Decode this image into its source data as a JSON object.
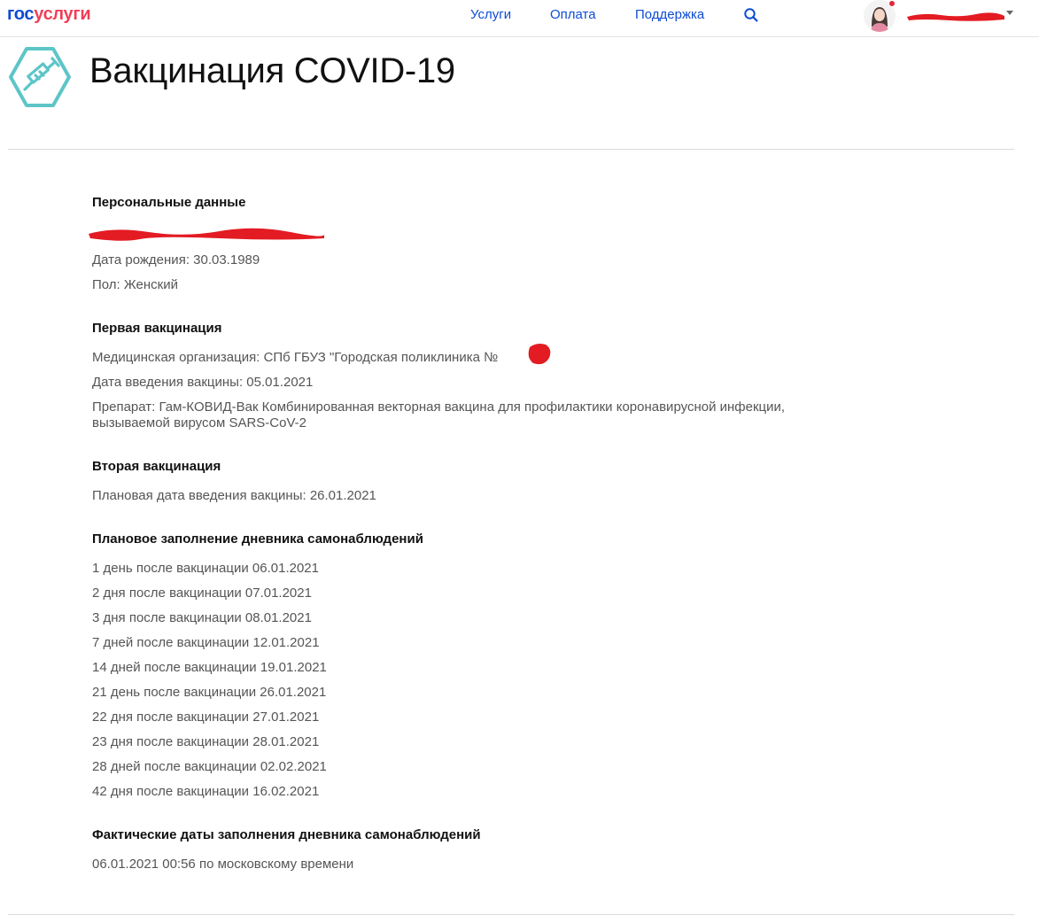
{
  "header": {
    "logo_part1": "гос",
    "logo_part2": "услуги",
    "nav": [
      {
        "label": "Услуги"
      },
      {
        "label": "Оплата"
      },
      {
        "label": "Поддержка"
      }
    ],
    "accent_color": "#0d4cd3",
    "brand_red": "#ee3f58",
    "icons": [
      "search-icon",
      "avatar-icon",
      "chevron-down-icon"
    ]
  },
  "page": {
    "title": "Вакцинация COVID-19",
    "icon": "syringe-icon"
  },
  "personal": {
    "heading": "Персональные данные",
    "birth_date": "Дата рождения: 30.03.1989",
    "sex": "Пол: Женский"
  },
  "first_vaccination": {
    "heading": "Первая вакцинация",
    "organization": "Медицинская организация: СПб ГБУЗ \"Городская поликлиника №",
    "date": "Дата введения вакцины: 05.01.2021",
    "drug": "Препарат: Гам-КОВИД-Вак Комбинированная векторная вакцина для профилактики коронавирусной инфекции, вызываемой вирусом SARS-CoV-2"
  },
  "second_vaccination": {
    "heading": "Вторая вакцинация",
    "planned_date": "Плановая дата введения вакцины: 26.01.2021"
  },
  "diary_plan": {
    "heading": "Плановое заполнение дневника самонаблюдений",
    "items": [
      "1 день после вакцинации 06.01.2021",
      "2 дня после вакцинации 07.01.2021",
      "3 дня после вакцинации 08.01.2021",
      "7 дней после вакцинации 12.01.2021",
      "14 дней после вакцинации 19.01.2021",
      "21 день после вакцинации 26.01.2021",
      "22 дня после вакцинации 27.01.2021",
      "23 дня после вакцинации 28.01.2021",
      "28 дней после вакцинации 02.02.2021",
      "42 дня после вакцинации 16.02.2021"
    ]
  },
  "diary_actual": {
    "heading": "Фактические даты заполнения дневника самонаблюдений",
    "items": [
      "06.01.2021 00:56 по московскому времени"
    ]
  }
}
